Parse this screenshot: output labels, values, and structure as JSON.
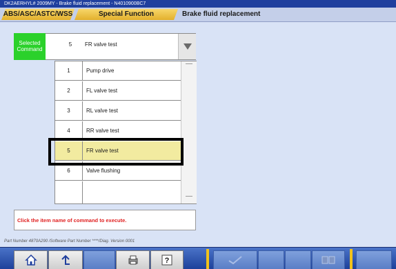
{
  "window": {
    "title": "DK2AERHYL# 2009MY   -   Brake fluid replacement   -   N4010900BC7"
  },
  "tabs": [
    {
      "label": "ABS/ASC/ASTC/WSS"
    },
    {
      "label": "Special Function"
    },
    {
      "label": "Brake fluid replacement"
    }
  ],
  "selected": {
    "badge": "Selected Command",
    "number": "5",
    "label": "FR valve test"
  },
  "list": {
    "items": [
      {
        "number": "1",
        "label": "Pump drive"
      },
      {
        "number": "2",
        "label": "FL valve test"
      },
      {
        "number": "3",
        "label": "RL valve test"
      },
      {
        "number": "4",
        "label": "RR valve test"
      },
      {
        "number": "5",
        "label": "FR valve test"
      },
      {
        "number": "6",
        "label": "Valve flushing"
      },
      {
        "number": "",
        "label": ""
      }
    ],
    "highlighted_index": 4
  },
  "message": "Click the item name of command to execute.",
  "part_info": "Part Number 4870A290 /Software Part Number ****/Diag. Version 0001",
  "toolbar": {
    "icons": [
      "home-icon",
      "back-icon",
      "print-icon",
      "help-icon",
      "check-icon",
      "compare-icon"
    ]
  }
}
